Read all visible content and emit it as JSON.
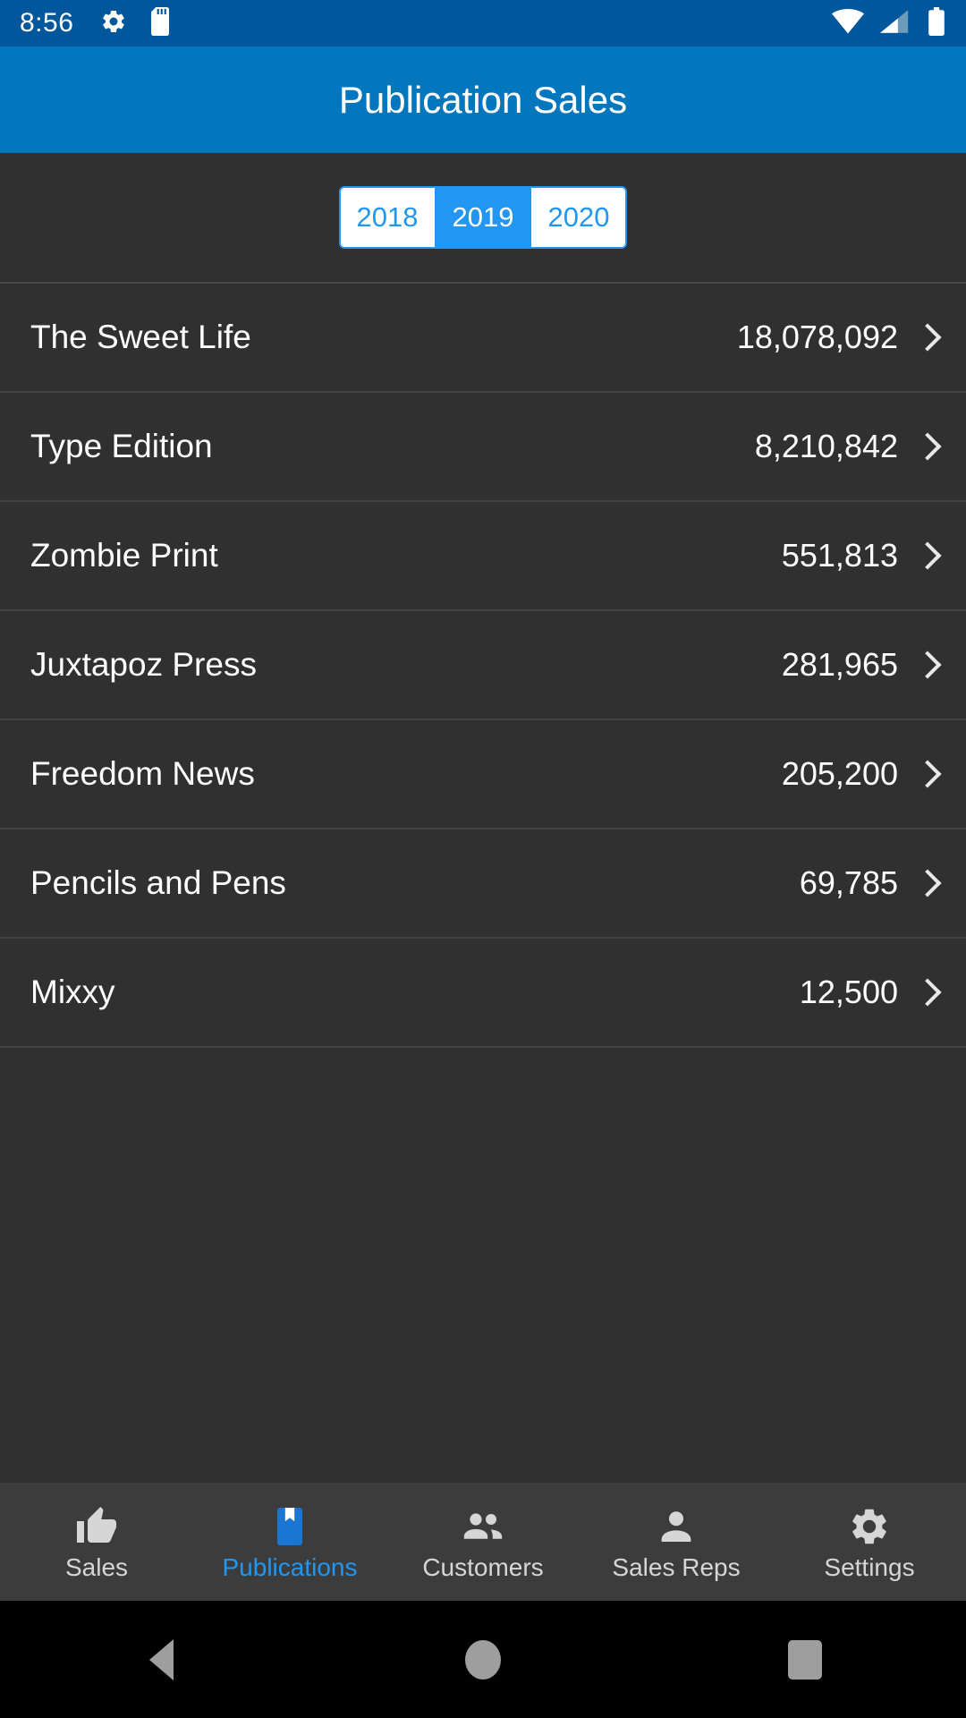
{
  "status_bar": {
    "time": "8:56",
    "left_icons": [
      "gear-icon",
      "sd-card-icon"
    ],
    "right_icons": [
      "wifi-icon",
      "cell-signal-icon",
      "battery-icon"
    ],
    "background_color": "#01579B"
  },
  "app_bar": {
    "title": "Publication Sales",
    "background_color": "#0277BD"
  },
  "year_filter": {
    "options": [
      "2018",
      "2019",
      "2020"
    ],
    "selected": "2019",
    "accent_color": "#2196F3"
  },
  "list": {
    "rows": [
      {
        "name": "The Sweet Life",
        "value": "18,078,092",
        "chevron": "chevron-right-icon"
      },
      {
        "name": "Type Edition",
        "value": "8,210,842",
        "chevron": "chevron-right-icon"
      },
      {
        "name": "Zombie Print",
        "value": "551,813",
        "chevron": "chevron-right-icon"
      },
      {
        "name": "Juxtapoz Press",
        "value": "281,965",
        "chevron": "chevron-right-icon"
      },
      {
        "name": "Freedom News",
        "value": "205,200",
        "chevron": "chevron-right-icon"
      },
      {
        "name": "Pencils and Pens",
        "value": "69,785",
        "chevron": "chevron-right-icon"
      },
      {
        "name": "Mixxy",
        "value": "12,500",
        "chevron": "chevron-right-icon"
      }
    ]
  },
  "tab_bar": {
    "active": "Publications",
    "active_color": "#2196F3",
    "inactive_color": "#d6d6d6",
    "tabs": [
      {
        "label": "Sales",
        "icon": "thumbs-up-icon"
      },
      {
        "label": "Publications",
        "icon": "book-bookmark-icon"
      },
      {
        "label": "Customers",
        "icon": "people-icon"
      },
      {
        "label": "Sales Reps",
        "icon": "person-icon"
      },
      {
        "label": "Settings",
        "icon": "gear-icon"
      }
    ]
  },
  "nav_bar": {
    "buttons": [
      {
        "name": "back",
        "icon": "triangle-back-icon"
      },
      {
        "name": "home",
        "icon": "circle-home-icon"
      },
      {
        "name": "recents",
        "icon": "square-recents-icon"
      }
    ]
  }
}
